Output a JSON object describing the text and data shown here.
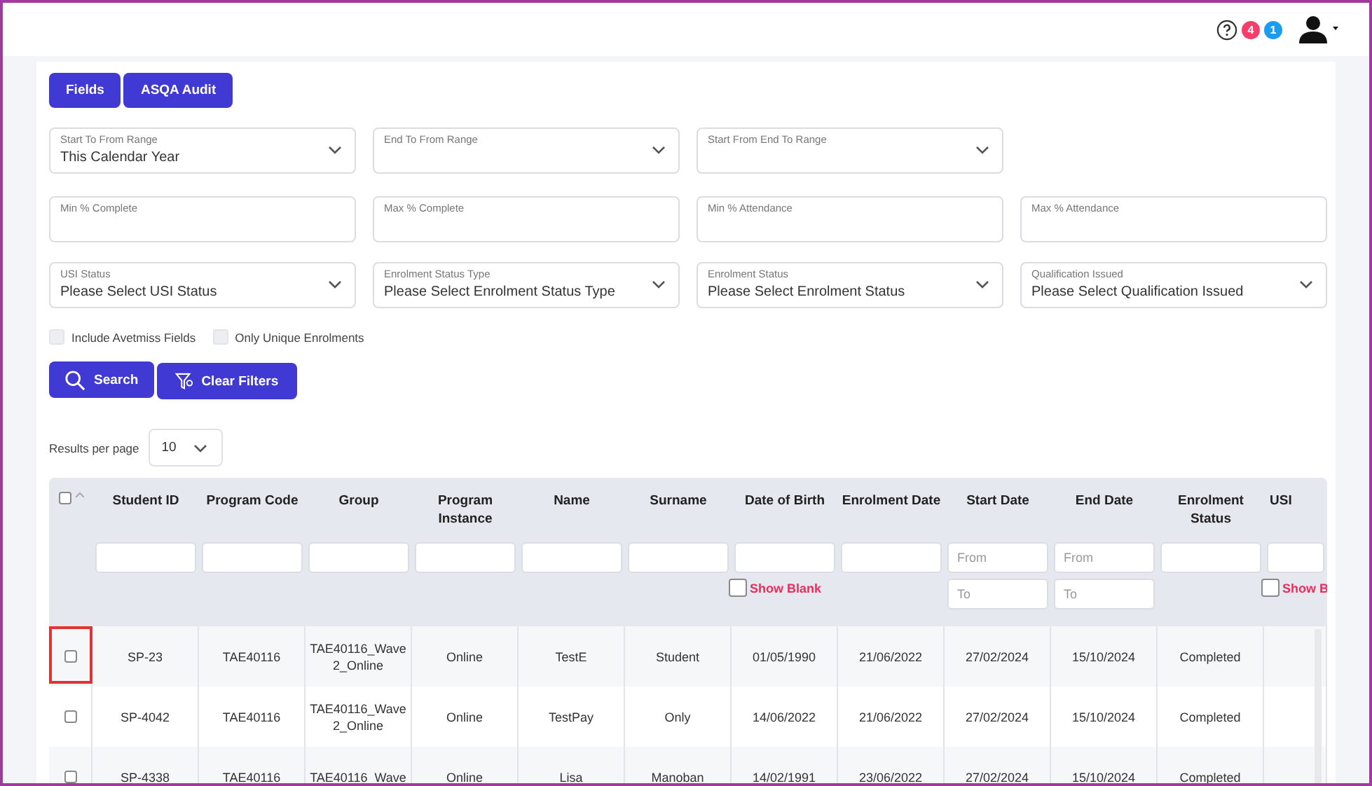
{
  "topbar": {
    "badges": [
      {
        "count": "4",
        "color": "#f43f6b"
      },
      {
        "count": "1",
        "color": "#1a9cf0"
      }
    ]
  },
  "buttons": [
    {
      "label": "Fields"
    },
    {
      "label": "ASQA Audit"
    }
  ],
  "filter_rows": [
    [
      {
        "kind": "select",
        "label": "Start To From Range",
        "value": "This Calendar Year"
      },
      {
        "kind": "select",
        "label": "End To From Range"
      },
      {
        "kind": "select",
        "label": "Start From End To Range"
      }
    ],
    [
      {
        "kind": "input",
        "label": "Min % Complete"
      },
      {
        "kind": "input",
        "label": "Max % Complete"
      },
      {
        "kind": "input",
        "label": "Min % Attendance"
      },
      {
        "kind": "input",
        "label": "Max % Attendance"
      }
    ],
    [
      {
        "kind": "select",
        "label": "USI Status",
        "value": "Please Select USI Status"
      },
      {
        "kind": "select",
        "label": "Enrolment Status Type",
        "value": "Please Select Enrolment Status Type"
      },
      {
        "kind": "select",
        "label": "Enrolment Status",
        "value": "Please Select Enrolment Status"
      },
      {
        "kind": "select",
        "label": "Qualification Issued",
        "value": "Please Select Qualification Issued"
      }
    ]
  ],
  "checkboxes": [
    {
      "label": "Include Avetmiss Fields",
      "checked": false
    },
    {
      "label": "Only Unique Enrolments",
      "checked": false
    }
  ],
  "actions": [
    {
      "kind": "search",
      "label": "Search"
    },
    {
      "kind": "clear",
      "label": "Clear Filters"
    }
  ],
  "results_per_page": {
    "label": "Results per page",
    "value": "10"
  },
  "table": {
    "select_all": false,
    "columns": [
      {
        "label": "Student ID",
        "filter": {
          "kind": "text"
        }
      },
      {
        "label": "Program Code",
        "filter": {
          "kind": "text"
        }
      },
      {
        "label": "Group",
        "filter": {
          "kind": "text"
        }
      },
      {
        "label": "Program Instance",
        "filter": {
          "kind": "text"
        }
      },
      {
        "label": "Name",
        "filter": {
          "kind": "text"
        }
      },
      {
        "label": "Surname",
        "filter": {
          "kind": "text"
        }
      },
      {
        "label": "Date of Birth",
        "filter": {
          "kind": "text",
          "blank": {
            "label": "Show Blank",
            "checked": false
          }
        }
      },
      {
        "label": "Enrolment Date",
        "filter": {
          "kind": "text"
        }
      },
      {
        "label": "Start Date",
        "filter": {
          "kind": "range",
          "from": {
            "placeholder": "From"
          },
          "to": {
            "placeholder": "To"
          }
        }
      },
      {
        "label": "End Date",
        "filter": {
          "kind": "range",
          "from": {
            "placeholder": "From"
          },
          "to": {
            "placeholder": "To"
          }
        }
      },
      {
        "label": "Enrolment Status",
        "filter": {
          "kind": "text"
        }
      },
      {
        "label": "USI",
        "filter": {
          "kind": "text",
          "blank": {
            "label": "Show B",
            "checked": false
          }
        }
      }
    ],
    "rows": [
      {
        "selected": false,
        "highlighted": true,
        "cells": [
          "SP-23",
          "TAE40116",
          "TAE40116_Wave 2_Online",
          "Online",
          "TestE",
          "Student",
          "01/05/1990",
          "21/06/2022",
          "27/02/2024",
          "15/10/2024",
          "Completed"
        ]
      },
      {
        "selected": false,
        "highlighted": false,
        "cells": [
          "SP-4042",
          "TAE40116",
          "TAE40116_Wave 2_Online",
          "Online",
          "TestPay",
          "Only",
          "14/06/2022",
          "21/06/2022",
          "27/02/2024",
          "15/10/2024",
          "Completed"
        ]
      },
      {
        "selected": false,
        "highlighted": false,
        "cells": [
          "SP-4338",
          "TAE40116",
          "TAE40116_Wave",
          "Online",
          "Lisa",
          "Manoban",
          "14/02/1991",
          "23/06/2022",
          "27/02/2024",
          "15/10/2024",
          "Completed"
        ]
      }
    ]
  }
}
